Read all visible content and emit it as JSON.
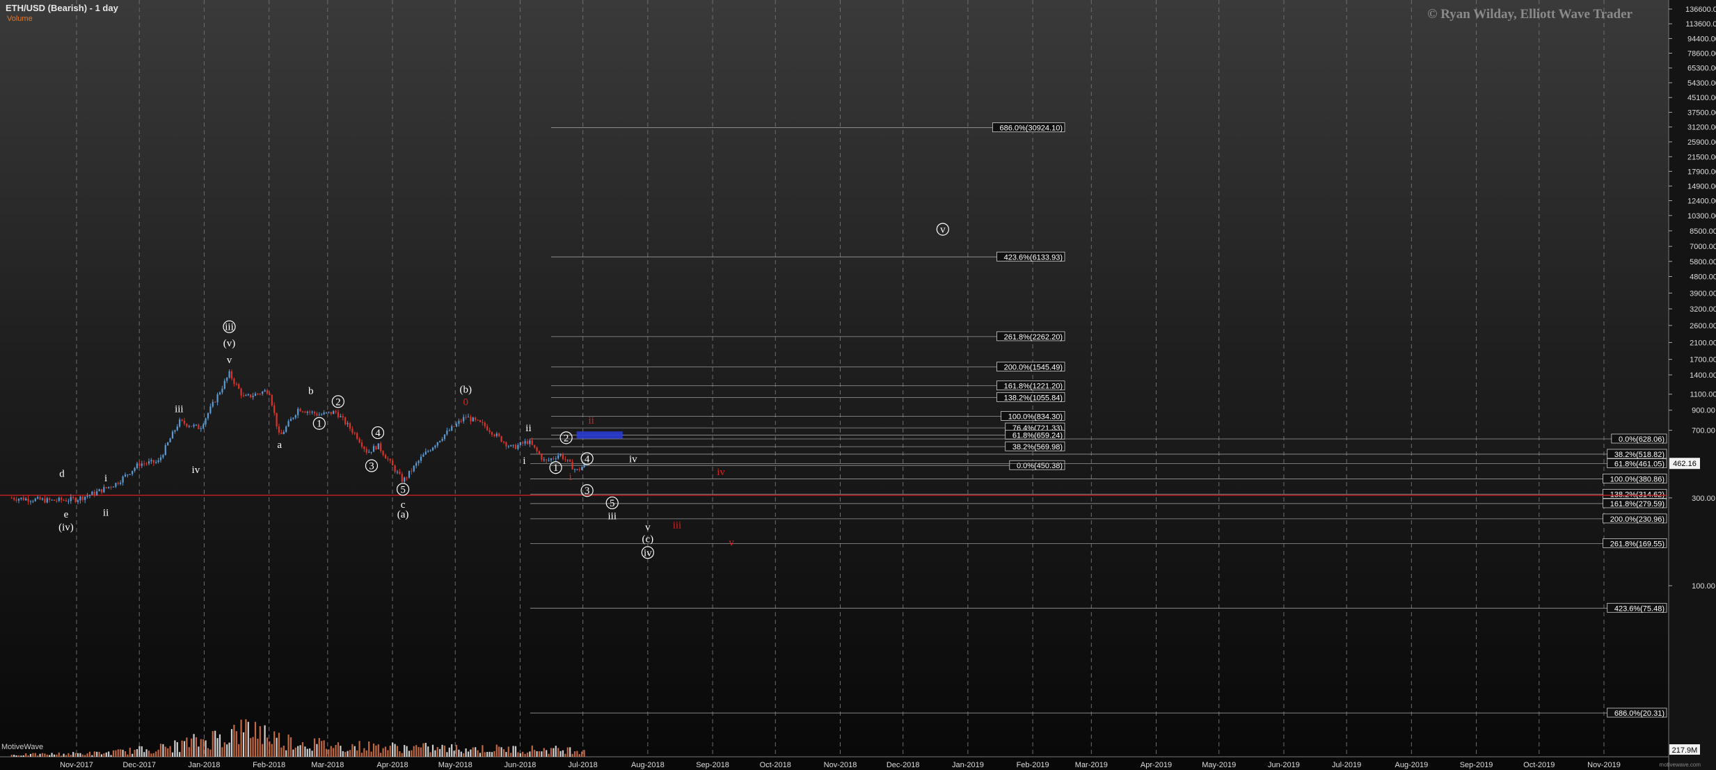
{
  "title": "ETH/USD (Bearish) - 1 day",
  "volume_label": "Volume",
  "indicator_label": "MotiveWave",
  "watermark": "© Ryan Wilday, Elliott Wave Trader",
  "brand_text": "motivewave.com",
  "chart_data": {
    "type": "candlestick",
    "scale": "log",
    "grid": "vertical dashed",
    "price_axis": {
      "ticks": [
        "136600.00",
        "113600.00",
        "94400.00",
        "78600.00",
        "65300.00",
        "54300.00",
        "45100.00",
        "37500.00",
        "31200.00",
        "25900.00",
        "21500.00",
        "17900.00",
        "14900.00",
        "12400.00",
        "10300.00",
        "8500.00",
        "7000.00",
        "5800.00",
        "4800.00",
        "3900.00",
        "3200.00",
        "2600.00",
        "2100.00",
        "1700.00",
        "1400.00",
        "1100.00",
        "900.00",
        "700.00",
        "300.00",
        "100.00"
      ],
      "tick_values": [
        136600,
        113600,
        94400,
        78600,
        65300,
        54300,
        45100,
        37500,
        31200,
        25900,
        21500,
        17900,
        14900,
        12400,
        10300,
        8500,
        7000,
        5800,
        4800,
        3900,
        3200,
        2600,
        2100,
        1700,
        1400,
        1100,
        900,
        700,
        300,
        100
      ],
      "last_price": "462.16",
      "volume_last": "217.9M"
    },
    "time_axis": [
      "Nov-2017",
      "Dec-2017",
      "Jan-2018",
      "Feb-2018",
      "Mar-2018",
      "Apr-2018",
      "May-2018",
      "Jun-2018",
      "Jul-2018",
      "Aug-2018",
      "Sep-2018",
      "Oct-2018",
      "Nov-2018",
      "Dec-2018",
      "Jan-2019",
      "Feb-2019",
      "Mar-2019",
      "Apr-2019",
      "May-2019",
      "Jun-2019",
      "Jul-2019",
      "Aug-2019",
      "Sep-2019",
      "Oct-2019",
      "Nov-2019"
    ],
    "price_path": [
      [
        "2017-10-01",
        300
      ],
      [
        "2017-10-20",
        290
      ],
      [
        "2017-11-01",
        295
      ],
      [
        "2017-11-10",
        320
      ],
      [
        "2017-11-20",
        360
      ],
      [
        "2017-12-01",
        460
      ],
      [
        "2017-12-10",
        470
      ],
      [
        "2017-12-20",
        780
      ],
      [
        "2017-12-30",
        720
      ],
      [
        "2018-01-13",
        1420
      ],
      [
        "2018-01-20",
        1050
      ],
      [
        "2018-02-01",
        1160
      ],
      [
        "2018-02-06",
        640
      ],
      [
        "2018-02-15",
        920
      ],
      [
        "2018-02-25",
        850
      ],
      [
        "2018-03-05",
        880
      ],
      [
        "2018-03-15",
        650
      ],
      [
        "2018-03-20",
        530
      ],
      [
        "2018-03-25",
        580
      ],
      [
        "2018-04-06",
        370
      ],
      [
        "2018-04-15",
        500
      ],
      [
        "2018-04-25",
        650
      ],
      [
        "2018-05-06",
        830
      ],
      [
        "2018-05-15",
        740
      ],
      [
        "2018-05-28",
        560
      ],
      [
        "2018-06-05",
        610
      ],
      [
        "2018-06-13",
        470
      ],
      [
        "2018-06-20",
        520
      ],
      [
        "2018-06-28",
        420
      ],
      [
        "2018-07-02",
        455
      ]
    ],
    "volume_path": [
      [
        "2017-10-01",
        0.05
      ],
      [
        "2017-11-15",
        0.1
      ],
      [
        "2017-12-15",
        0.25
      ],
      [
        "2018-01-10",
        0.55
      ],
      [
        "2018-01-25",
        0.75
      ],
      [
        "2018-02-06",
        0.45
      ],
      [
        "2018-03-01",
        0.3
      ],
      [
        "2018-04-01",
        0.25
      ],
      [
        "2018-05-01",
        0.22
      ],
      [
        "2018-06-01",
        0.2
      ],
      [
        "2018-07-02",
        0.18
      ]
    ],
    "fib_upper": [
      {
        "label": "686.0%(30924.10)",
        "value": 30924.1
      },
      {
        "label": "423.6%(6133.93)",
        "value": 6133.93
      },
      {
        "label": "261.8%(2262.20)",
        "value": 2262.2
      },
      {
        "label": "200.0%(1545.49)",
        "value": 1545.49
      },
      {
        "label": "161.8%(1221.20)",
        "value": 1221.2
      },
      {
        "label": "138.2%(1055.84)",
        "value": 1055.84
      },
      {
        "label": "100.0%(834.30)",
        "value": 834.3
      },
      {
        "label": "76.4%(721.33)",
        "value": 721.33
      },
      {
        "label": "61.8%(659.24)",
        "value": 659.24
      },
      {
        "label": "38.2%(569.98)",
        "value": 569.98
      },
      {
        "label": "0.0%(450.38)",
        "value": 450.38
      }
    ],
    "fib_right": [
      {
        "label": "0.0%(628.06)",
        "value": 628.06
      },
      {
        "label": "38.2%(518.82)",
        "value": 518.82
      },
      {
        "label": "61.8%(461.05)",
        "value": 461.05
      },
      {
        "label": "100.0%(380.86)",
        "value": 380.86
      },
      {
        "label": "138.2%(314.62)",
        "value": 314.62
      },
      {
        "label": "161.8%(279.59)",
        "value": 279.59
      },
      {
        "label": "200.0%(230.96)",
        "value": 230.96
      },
      {
        "label": "261.8%(169.55)",
        "value": 169.55
      },
      {
        "label": "423.6%(75.48)",
        "value": 75.48
      },
      {
        "label": "686.0%(20.31)",
        "value": 20.31
      }
    ],
    "support_line": 310,
    "target_box": {
      "from": "2018-06-28",
      "to": "2018-07-20",
      "low": 630,
      "high": 690
    },
    "wave_labels": [
      {
        "text": "d",
        "date": "2017-10-25",
        "price": 390,
        "color": "#ffffff"
      },
      {
        "text": "e",
        "date": "2017-10-27",
        "price": 235,
        "color": "#ffffff"
      },
      {
        "text": "(iv)",
        "date": "2017-10-27",
        "price": 200,
        "color": "#ffffff"
      },
      {
        "text": "i",
        "date": "2017-11-15",
        "price": 370,
        "color": "#ffffff"
      },
      {
        "text": "ii",
        "date": "2017-11-15",
        "price": 240,
        "color": "#ffffff"
      },
      {
        "text": "iii",
        "date": "2017-12-20",
        "price": 880,
        "color": "#ffffff"
      },
      {
        "text": "iv",
        "date": "2017-12-28",
        "price": 410,
        "color": "#ffffff"
      },
      {
        "text": "iii",
        "date": "2018-01-13",
        "price": 2450,
        "color": "#ffffff",
        "circled": true
      },
      {
        "text": "(v)",
        "date": "2018-01-13",
        "price": 2000,
        "color": "#ffffff"
      },
      {
        "text": "v",
        "date": "2018-01-13",
        "price": 1620,
        "color": "#ffffff"
      },
      {
        "text": "a",
        "date": "2018-02-06",
        "price": 560,
        "color": "#ffffff"
      },
      {
        "text": "b",
        "date": "2018-02-21",
        "price": 1100,
        "color": "#ffffff"
      },
      {
        "text": "1",
        "date": "2018-02-25",
        "price": 730,
        "color": "#ffffff",
        "circled": true
      },
      {
        "text": "2",
        "date": "2018-03-06",
        "price": 960,
        "color": "#ffffff",
        "circled": true
      },
      {
        "text": "3",
        "date": "2018-03-22",
        "price": 430,
        "color": "#ffffff",
        "circled": true
      },
      {
        "text": "4",
        "date": "2018-03-25",
        "price": 650,
        "color": "#ffffff",
        "circled": true
      },
      {
        "text": "5",
        "date": "2018-04-06",
        "price": 320,
        "color": "#ffffff",
        "circled": true
      },
      {
        "text": "c",
        "date": "2018-04-06",
        "price": 265,
        "color": "#ffffff"
      },
      {
        "text": "(a)",
        "date": "2018-04-06",
        "price": 235,
        "color": "#ffffff"
      },
      {
        "text": "(b)",
        "date": "2018-05-06",
        "price": 1120,
        "color": "#ffffff"
      },
      {
        "text": "0",
        "date": "2018-05-06",
        "price": 960,
        "color": "#e02020"
      },
      {
        "text": "ii",
        "date": "2018-06-05",
        "price": 690,
        "color": "#ffffff"
      },
      {
        "text": "i",
        "date": "2018-06-03",
        "price": 460,
        "color": "#ffffff"
      },
      {
        "text": "2",
        "date": "2018-06-23",
        "price": 610,
        "color": "#ffffff",
        "circled": true
      },
      {
        "text": "1",
        "date": "2018-06-18",
        "price": 420,
        "color": "#ffffff",
        "circled": true
      },
      {
        "text": "i",
        "date": "2018-06-25",
        "price": 375,
        "color": "#e02020"
      },
      {
        "text": "4",
        "date": "2018-07-03",
        "price": 470,
        "color": "#ffffff",
        "circled": true
      },
      {
        "text": "3",
        "date": "2018-07-03",
        "price": 315,
        "color": "#ffffff",
        "circled": true
      },
      {
        "text": "iv",
        "date": "2018-07-25",
        "price": 470,
        "color": "#ffffff"
      },
      {
        "text": "ii",
        "date": "2018-07-05",
        "price": 760,
        "color": "#e02020"
      },
      {
        "text": "5",
        "date": "2018-07-15",
        "price": 270,
        "color": "#ffffff",
        "circled": true
      },
      {
        "text": "iii",
        "date": "2018-07-15",
        "price": 230,
        "color": "#ffffff"
      },
      {
        "text": "v",
        "date": "2018-08-01",
        "price": 200,
        "color": "#ffffff"
      },
      {
        "text": "(c)",
        "date": "2018-08-01",
        "price": 172,
        "color": "#ffffff"
      },
      {
        "text": "iv",
        "date": "2018-08-01",
        "price": 145,
        "color": "#ffffff",
        "circled": true
      },
      {
        "text": "iii",
        "date": "2018-08-15",
        "price": 205,
        "color": "#e02020"
      },
      {
        "text": "iv",
        "date": "2018-09-05",
        "price": 400,
        "color": "#e02020"
      },
      {
        "text": "v",
        "date": "2018-09-10",
        "price": 165,
        "color": "#e02020"
      },
      {
        "text": "v",
        "date": "2018-12-20",
        "price": 8300,
        "color": "#ffffff",
        "circled": true
      }
    ]
  },
  "colors": {
    "up_candle": "#5b9bd5",
    "down_candle": "#d9342b",
    "support": "#cc1f1f",
    "fib_line": "#9a9a9a",
    "target_box": "#2a3bd1",
    "volume_bar": "#d67248"
  }
}
